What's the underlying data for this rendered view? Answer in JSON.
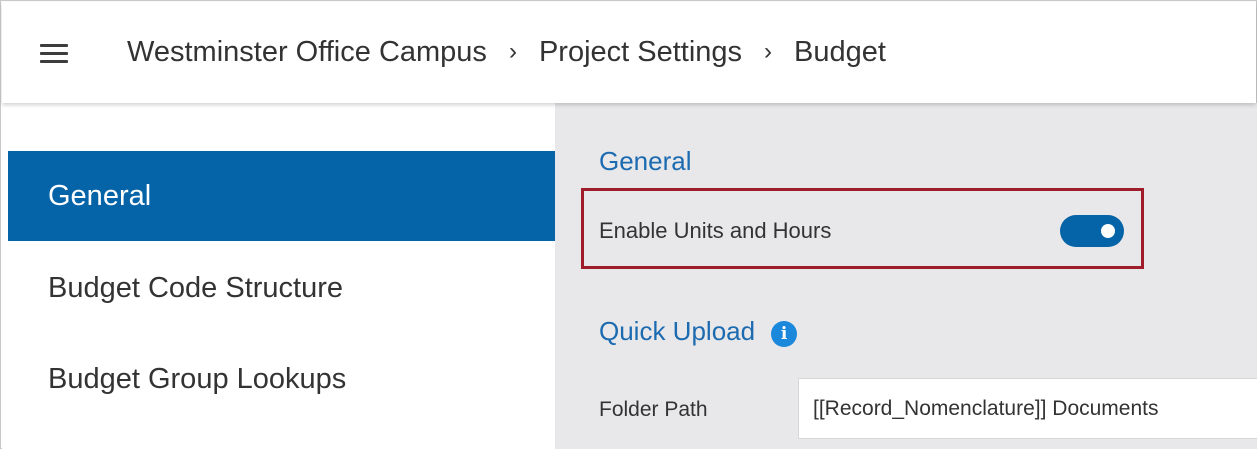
{
  "header": {
    "breadcrumb": [
      "Westminster Office Campus",
      "Project Settings",
      "Budget"
    ],
    "separator": "›"
  },
  "sidebar": {
    "items": [
      {
        "label": "General",
        "active": true
      },
      {
        "label": "Budget Code Structure",
        "active": false
      },
      {
        "label": "Budget Group Lookups",
        "active": false
      }
    ]
  },
  "main": {
    "general_title": "General",
    "enable_units_label": "Enable Units and Hours",
    "enable_units_on": true,
    "quick_upload_title": "Quick Upload",
    "info_glyph": "i",
    "folder_path_label": "Folder Path",
    "folder_path_value": "[[Record_Nomenclature]] Documents"
  },
  "colors": {
    "accent": "#0563a8",
    "section_title": "#1c6ab0",
    "highlight": "#9f1d2a",
    "panel_bg": "#e8e8ea",
    "info_icon": "#1b88db"
  },
  "icons": {
    "menu": "hamburger-menu-icon",
    "info": "info-icon",
    "separator": "chevron-right-icon"
  }
}
